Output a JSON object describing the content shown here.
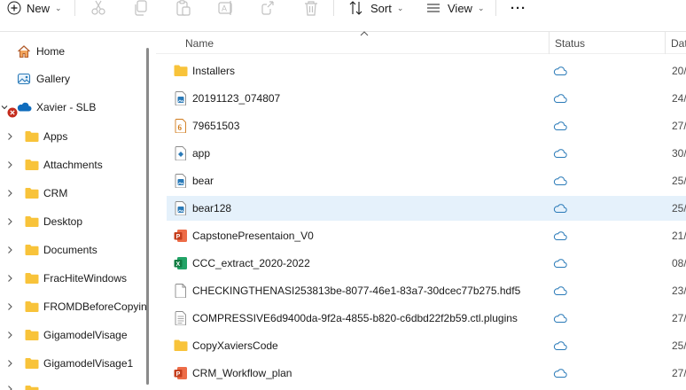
{
  "toolbar": {
    "new_label": "New",
    "sort_label": "Sort",
    "view_label": "View",
    "more_label": "···"
  },
  "sidebar": {
    "home": "Home",
    "gallery": "Gallery",
    "account": "Xavier - SLB",
    "folders": [
      "Apps",
      "Attachments",
      "CRM",
      "Desktop",
      "Documents",
      "FracHiteWindows",
      "FROMDBeforeCopying",
      "GigamodelVisage",
      "GigamodelVisage1"
    ]
  },
  "columns": {
    "name": "Name",
    "status": "Status",
    "date": "Dat"
  },
  "files": [
    {
      "name": "Installers",
      "icon": "folder-icon",
      "date": "20/"
    },
    {
      "name": "20191123_074807",
      "icon": "image-file-icon",
      "date": "24/"
    },
    {
      "name": "79651503",
      "icon": "archive-file-icon",
      "date": "27/"
    },
    {
      "name": "app",
      "icon": "app-file-icon",
      "date": "30/"
    },
    {
      "name": "bear",
      "icon": "image-file-icon",
      "date": "25/"
    },
    {
      "name": "bear128",
      "icon": "image-file-icon",
      "date": "25/",
      "selected": true
    },
    {
      "name": "CapstonePresentaion_V0",
      "icon": "powerpoint-icon",
      "date": "21/"
    },
    {
      "name": "CCC_extract_2020-2022",
      "icon": "excel-icon",
      "date": "08/"
    },
    {
      "name": "CHECKINGTHENASI253813be-8077-46e1-83a7-30dcec77b275.hdf5",
      "icon": "blank-file-icon",
      "date": "23/"
    },
    {
      "name": "COMPRESSIVE6d9400da-9f2a-4855-b820-c6dbd22f2b59.ctl.plugins",
      "icon": "text-file-icon",
      "date": "27/"
    },
    {
      "name": "CopyXaviersCode",
      "icon": "folder-icon",
      "date": "25/"
    },
    {
      "name": "CRM_Workflow_plan",
      "icon": "powerpoint-icon",
      "date": "27/"
    }
  ],
  "colors": {
    "folder": "#f8c33a",
    "selection": "#e5f1fb",
    "cloud": "#2a7ab8",
    "onedrive": "#0f6cbd",
    "powerpoint": "#c43e1c",
    "excel": "#107c41",
    "error": "#c42b1c"
  }
}
